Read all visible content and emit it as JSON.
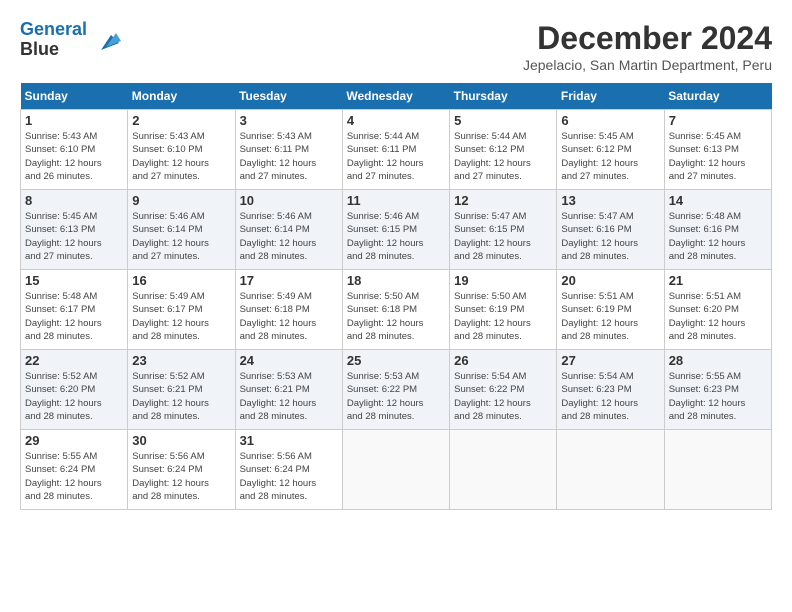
{
  "header": {
    "logo_line1": "General",
    "logo_line2": "Blue",
    "month": "December 2024",
    "location": "Jepelacio, San Martin Department, Peru"
  },
  "weekdays": [
    "Sunday",
    "Monday",
    "Tuesday",
    "Wednesday",
    "Thursday",
    "Friday",
    "Saturday"
  ],
  "weeks": [
    [
      {
        "day": "1",
        "lines": [
          "Sunrise: 5:43 AM",
          "Sunset: 6:10 PM",
          "Daylight: 12 hours",
          "and 26 minutes."
        ]
      },
      {
        "day": "2",
        "lines": [
          "Sunrise: 5:43 AM",
          "Sunset: 6:10 PM",
          "Daylight: 12 hours",
          "and 27 minutes."
        ]
      },
      {
        "day": "3",
        "lines": [
          "Sunrise: 5:43 AM",
          "Sunset: 6:11 PM",
          "Daylight: 12 hours",
          "and 27 minutes."
        ]
      },
      {
        "day": "4",
        "lines": [
          "Sunrise: 5:44 AM",
          "Sunset: 6:11 PM",
          "Daylight: 12 hours",
          "and 27 minutes."
        ]
      },
      {
        "day": "5",
        "lines": [
          "Sunrise: 5:44 AM",
          "Sunset: 6:12 PM",
          "Daylight: 12 hours",
          "and 27 minutes."
        ]
      },
      {
        "day": "6",
        "lines": [
          "Sunrise: 5:45 AM",
          "Sunset: 6:12 PM",
          "Daylight: 12 hours",
          "and 27 minutes."
        ]
      },
      {
        "day": "7",
        "lines": [
          "Sunrise: 5:45 AM",
          "Sunset: 6:13 PM",
          "Daylight: 12 hours",
          "and 27 minutes."
        ]
      }
    ],
    [
      {
        "day": "8",
        "lines": [
          "Sunrise: 5:45 AM",
          "Sunset: 6:13 PM",
          "Daylight: 12 hours",
          "and 27 minutes."
        ]
      },
      {
        "day": "9",
        "lines": [
          "Sunrise: 5:46 AM",
          "Sunset: 6:14 PM",
          "Daylight: 12 hours",
          "and 27 minutes."
        ]
      },
      {
        "day": "10",
        "lines": [
          "Sunrise: 5:46 AM",
          "Sunset: 6:14 PM",
          "Daylight: 12 hours",
          "and 28 minutes."
        ]
      },
      {
        "day": "11",
        "lines": [
          "Sunrise: 5:46 AM",
          "Sunset: 6:15 PM",
          "Daylight: 12 hours",
          "and 28 minutes."
        ]
      },
      {
        "day": "12",
        "lines": [
          "Sunrise: 5:47 AM",
          "Sunset: 6:15 PM",
          "Daylight: 12 hours",
          "and 28 minutes."
        ]
      },
      {
        "day": "13",
        "lines": [
          "Sunrise: 5:47 AM",
          "Sunset: 6:16 PM",
          "Daylight: 12 hours",
          "and 28 minutes."
        ]
      },
      {
        "day": "14",
        "lines": [
          "Sunrise: 5:48 AM",
          "Sunset: 6:16 PM",
          "Daylight: 12 hours",
          "and 28 minutes."
        ]
      }
    ],
    [
      {
        "day": "15",
        "lines": [
          "Sunrise: 5:48 AM",
          "Sunset: 6:17 PM",
          "Daylight: 12 hours",
          "and 28 minutes."
        ]
      },
      {
        "day": "16",
        "lines": [
          "Sunrise: 5:49 AM",
          "Sunset: 6:17 PM",
          "Daylight: 12 hours",
          "and 28 minutes."
        ]
      },
      {
        "day": "17",
        "lines": [
          "Sunrise: 5:49 AM",
          "Sunset: 6:18 PM",
          "Daylight: 12 hours",
          "and 28 minutes."
        ]
      },
      {
        "day": "18",
        "lines": [
          "Sunrise: 5:50 AM",
          "Sunset: 6:18 PM",
          "Daylight: 12 hours",
          "and 28 minutes."
        ]
      },
      {
        "day": "19",
        "lines": [
          "Sunrise: 5:50 AM",
          "Sunset: 6:19 PM",
          "Daylight: 12 hours",
          "and 28 minutes."
        ]
      },
      {
        "day": "20",
        "lines": [
          "Sunrise: 5:51 AM",
          "Sunset: 6:19 PM",
          "Daylight: 12 hours",
          "and 28 minutes."
        ]
      },
      {
        "day": "21",
        "lines": [
          "Sunrise: 5:51 AM",
          "Sunset: 6:20 PM",
          "Daylight: 12 hours",
          "and 28 minutes."
        ]
      }
    ],
    [
      {
        "day": "22",
        "lines": [
          "Sunrise: 5:52 AM",
          "Sunset: 6:20 PM",
          "Daylight: 12 hours",
          "and 28 minutes."
        ]
      },
      {
        "day": "23",
        "lines": [
          "Sunrise: 5:52 AM",
          "Sunset: 6:21 PM",
          "Daylight: 12 hours",
          "and 28 minutes."
        ]
      },
      {
        "day": "24",
        "lines": [
          "Sunrise: 5:53 AM",
          "Sunset: 6:21 PM",
          "Daylight: 12 hours",
          "and 28 minutes."
        ]
      },
      {
        "day": "25",
        "lines": [
          "Sunrise: 5:53 AM",
          "Sunset: 6:22 PM",
          "Daylight: 12 hours",
          "and 28 minutes."
        ]
      },
      {
        "day": "26",
        "lines": [
          "Sunrise: 5:54 AM",
          "Sunset: 6:22 PM",
          "Daylight: 12 hours",
          "and 28 minutes."
        ]
      },
      {
        "day": "27",
        "lines": [
          "Sunrise: 5:54 AM",
          "Sunset: 6:23 PM",
          "Daylight: 12 hours",
          "and 28 minutes."
        ]
      },
      {
        "day": "28",
        "lines": [
          "Sunrise: 5:55 AM",
          "Sunset: 6:23 PM",
          "Daylight: 12 hours",
          "and 28 minutes."
        ]
      }
    ],
    [
      {
        "day": "29",
        "lines": [
          "Sunrise: 5:55 AM",
          "Sunset: 6:24 PM",
          "Daylight: 12 hours",
          "and 28 minutes."
        ]
      },
      {
        "day": "30",
        "lines": [
          "Sunrise: 5:56 AM",
          "Sunset: 6:24 PM",
          "Daylight: 12 hours",
          "and 28 minutes."
        ]
      },
      {
        "day": "31",
        "lines": [
          "Sunrise: 5:56 AM",
          "Sunset: 6:24 PM",
          "Daylight: 12 hours",
          "and 28 minutes."
        ]
      },
      null,
      null,
      null,
      null
    ]
  ]
}
